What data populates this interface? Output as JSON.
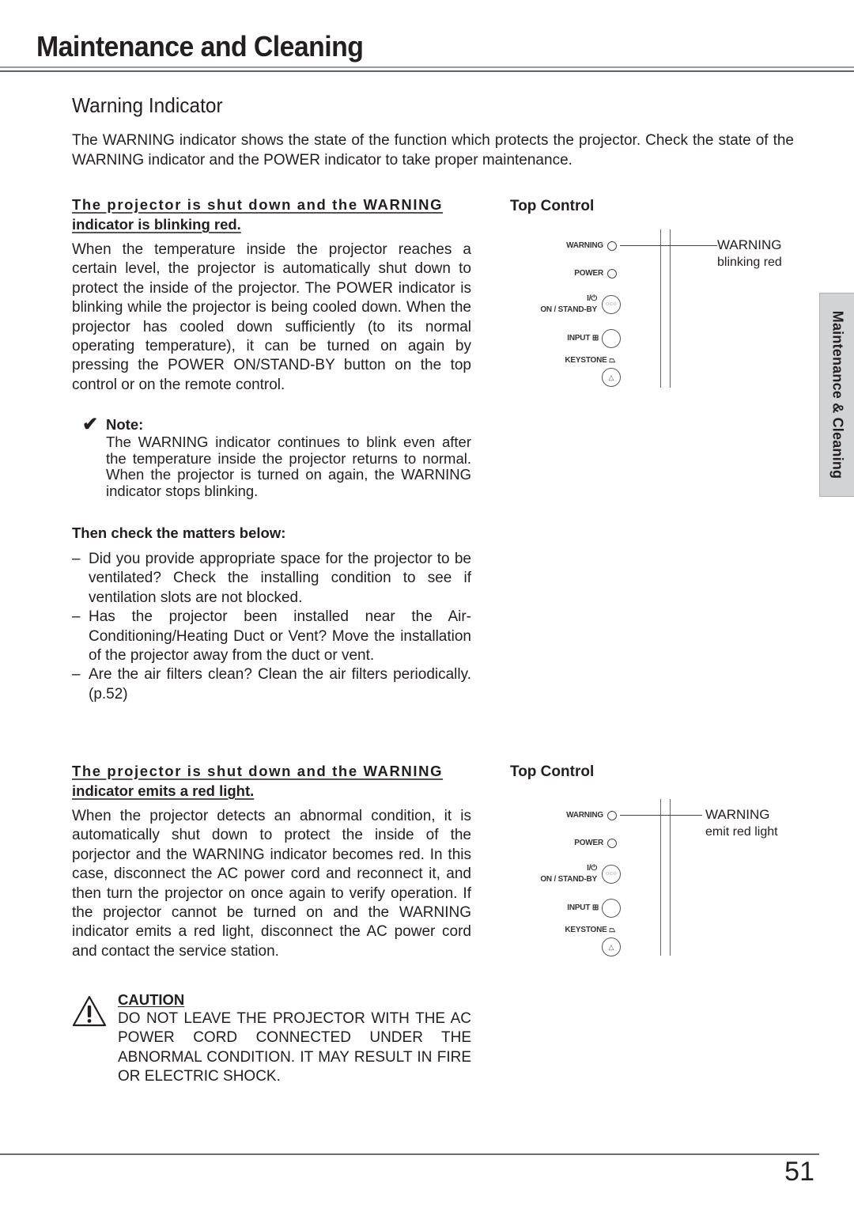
{
  "header": {
    "title": "Maintenance and Cleaning"
  },
  "section": {
    "title": "Warning Indicator",
    "intro": "The WARNING indicator shows the state of the function which protects the projector.  Check the state of the WARNING indicator and the POWER indicator to take proper maintenance."
  },
  "case1": {
    "heading_line1": "The projector is shut down and the WARNING",
    "heading_line2": "indicator is blinking red.",
    "body": "When the temperature inside the projector reaches a certain level, the projector is automatically shut down to protect the inside of the projector.  The POWER indicator is blinking while the projector is being cooled down.  When the projector has cooled down sufficiently (to its normal operating temperature), it can be turned on again by pressing the POWER ON/STAND-BY button on the top control or on the remote control.",
    "note": {
      "icon": "check-mark-icon",
      "label": "Note:",
      "text": "The WARNING indicator continues to blink even after the temperature inside the projector returns to normal.  When the projector is turned on again, the WARNING indicator stops blinking."
    },
    "matters_heading": "Then check the matters below:",
    "matters": [
      {
        "dash": "–",
        "text": "Did you provide appropriate space for the projector to be ventilated?  Check the installing condition to see if ventilation slots are not blocked."
      },
      {
        "dash": "–",
        "text": "Has the projector been installed near the Air-Conditioning/Heating Duct or Vent? Move the installation of the projector away from the duct or vent."
      },
      {
        "dash": "–",
        "text": "Are the air filters clean?  Clean the air filters periodically. (p.52)"
      }
    ],
    "diagram": {
      "title": "Top Control",
      "labels": {
        "warning": "WARNING",
        "power": "POWER",
        "onstandby_symbol": "I/⏻",
        "onstandby": "ON / STAND-BY",
        "input": "INPUT ⊞",
        "keystone": "KEYSTONE ⏢"
      },
      "callout_line1": "WARNING",
      "callout_line2": "blinking red"
    }
  },
  "case2": {
    "heading_line1": "The projector is shut down and the WARNING",
    "heading_line2": "indicator emits a red light.",
    "body": "When the projector detects an abnormal condition, it is automatically shut down to protect the inside of the porjector and the WARNING indicator becomes red.  In this case, disconnect the AC power cord and reconnect it, and then turn the projector on once again to verify operation. If the projector cannot be turned on and the WARNING indicator emits a red light, disconnect the AC power cord and contact the service station.",
    "caution": {
      "icon": "warning-triangle-icon",
      "label": "CAUTION",
      "text": "DO NOT LEAVE THE PROJECTOR WITH THE AC POWER CORD CONNECTED UNDER THE ABNORMAL CONDITION.  IT MAY RESULT IN FIRE OR ELECTRIC SHOCK."
    },
    "diagram": {
      "title": "Top Control",
      "labels": {
        "warning": "WARNING",
        "power": "POWER",
        "onstandby_symbol": "I/⏻",
        "onstandby": "ON / STAND-BY",
        "input": "INPUT ⊞",
        "keystone": "KEYSTONE ⏢"
      },
      "callout_line1": "WARNING",
      "callout_line2": "emit red light"
    }
  },
  "side_tab": {
    "label": "Maintenance & Cleaning"
  },
  "footer": {
    "page_number": "51"
  }
}
